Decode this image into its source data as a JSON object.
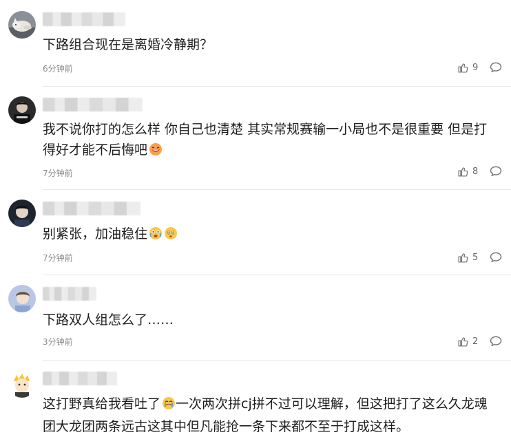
{
  "comments": [
    {
      "text": "下路组合现在是离婚冷静期？",
      "time": "6分钟前",
      "likes": "9"
    },
    {
      "text": "我不说你打的怎么样 你自己也清楚 其实常规赛输一小局也不是很重要 但是打得好才能不后悔吧",
      "time": "7分钟前",
      "likes": "8"
    },
    {
      "text": "别紧张，加油稳住",
      "time": "7分钟前",
      "likes": "5"
    },
    {
      "text": "下路双人组怎么了……",
      "time": "3分钟前",
      "likes": "2"
    },
    {
      "text": "这打野真给我看吐了",
      "text_after_emoji": "一次两次拼cj拼不过可以理解，但这把打了这么久龙魂团大龙团两条远古这其中但凡能抢一条下来都不至于打成这样。",
      "time": "",
      "likes": ""
    }
  ],
  "icons": {
    "like": "thumbs-up-icon",
    "reply": "speech-bubble-icon"
  },
  "colors": {
    "text": "#1f1f1f",
    "meta": "#8a8a8a",
    "icon": "#777777",
    "divider": "#e8e8e8"
  }
}
